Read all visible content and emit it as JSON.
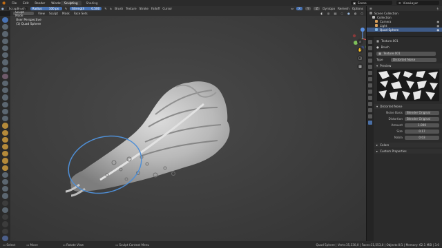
{
  "topbar": {
    "menus": [
      "File",
      "Edit",
      "Render",
      "Window",
      "Help"
    ],
    "workspace_tabs": [
      "Sculpting",
      "Shading"
    ],
    "active_tab": "Sculpting",
    "scene": "Scene",
    "view_layer": "ViewLayer"
  },
  "tool_header": {
    "brush": "ScrapBrush",
    "radius_label": "Radius",
    "radius_value": "100 px",
    "strength_label": "Strength",
    "strength_value": "0.500",
    "menus": [
      "Brush",
      "Texture",
      "Stroke",
      "Falloff",
      "Cursor"
    ],
    "dyntopo": "Dyntopo",
    "remesh": "Remesh",
    "options": "Options"
  },
  "view_header": {
    "mode": "Sculpt Mode",
    "menus": [
      "View",
      "Sculpt",
      "Mask",
      "Face Sets"
    ]
  },
  "viewport": {
    "line1": "User Perspective",
    "line2": "(1) Quad Sphere"
  },
  "outliner": {
    "title": "Scene Collection",
    "items": [
      {
        "label": "Collection",
        "color": "#cfcfcf"
      },
      {
        "label": "Camera",
        "color": "#d9a05b"
      },
      {
        "label": "Light",
        "color": "#d9a05b"
      },
      {
        "label": "Quad Sphere",
        "color": "#7fb3e0",
        "selected": true
      }
    ]
  },
  "properties": {
    "texture_name": "Texture.001",
    "brush_label": "Brush",
    "texture_slot": "Texture.001",
    "type_label": "Type",
    "type_value": "Distorted Noise",
    "preview_label": "Preview",
    "distorted_noise_label": "Distorted Noise",
    "noise_basis_label": "Noise Basis",
    "noise_basis_value": "Blender Original",
    "distortion_label": "Distortion",
    "distortion_value": "Blender Original",
    "amount_label": "Amount",
    "amount_value": "1.000",
    "size_label": "Size",
    "size_value": "0.17",
    "nabla_label": "Nabla",
    "nabla_value": "0.03",
    "colors_label": "Colors",
    "custom_props_label": "Custom Properties"
  },
  "statusbar": {
    "select": "Select",
    "move": "Move",
    "rotate": "Rotate View",
    "context": "Sculpt Context Menu",
    "stats": "Quad Sphere | Verts:35,330,0 | Faces:11,553,0 | Objects:0/1 | Memory: 62.1 MiB | 3.0"
  },
  "colors": {
    "accent": "#4772b3",
    "brush_ring": "#4f8fd6"
  }
}
